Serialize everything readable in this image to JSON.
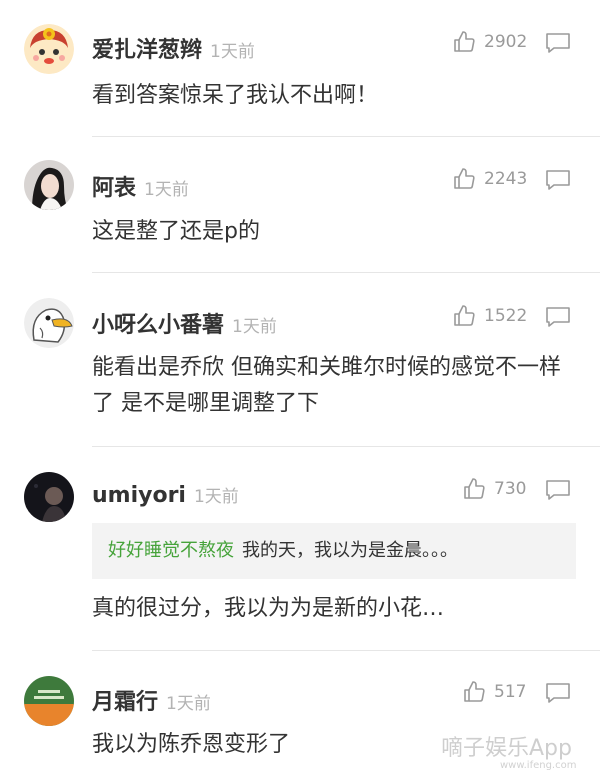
{
  "comments": [
    {
      "username": "爱扎洋葱辫",
      "time": "1天前",
      "likes": "2902",
      "text": "看到答案惊呆了我认不出啊！",
      "avatar_icon": "cartoon-girl-avatar"
    },
    {
      "username": "阿表",
      "time": "1天前",
      "likes": "2243",
      "text": "这是整了还是p的",
      "avatar_icon": "woman-photo-avatar"
    },
    {
      "username": "小呀么小番薯",
      "time": "1天前",
      "likes": "1522",
      "text": "能看出是乔欣 但确实和关雎尔时候的感觉不一样了 是不是哪里调整了下",
      "avatar_icon": "cartoon-duck-avatar"
    },
    {
      "username": "umiyori",
      "time": "1天前",
      "likes": "730",
      "quote": {
        "author": "好好睡觉不熬夜",
        "text": "我的天，我以为是金晨。。。"
      },
      "text": "真的很过分，我以为为是新的小花…",
      "avatar_icon": "dark-photo-avatar"
    },
    {
      "username": "月霜行",
      "time": "1天前",
      "likes": "517",
      "text": "我以为陈乔恩变形了",
      "avatar_icon": "green-orange-logo-avatar"
    }
  ],
  "watermark": {
    "brand": "嘀子娱乐App",
    "site": "www.ifeng.com"
  },
  "colors": {
    "username": "#333333",
    "timestamp": "#b3b3b3",
    "count": "#9a9a9a",
    "quote_author": "#46a33a",
    "quote_bg": "#f3f3f3",
    "divider": "#e6e6e6"
  }
}
